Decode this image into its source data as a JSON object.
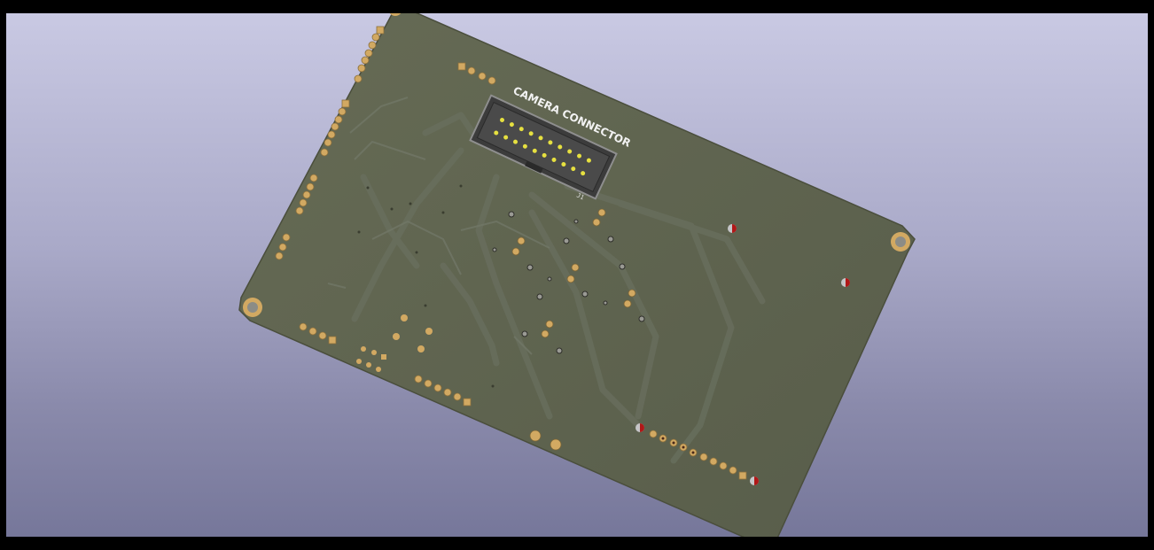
{
  "viewer": {
    "background_top": "#c9c9e3",
    "background_bottom": "#76779a"
  },
  "board": {
    "color": "#5f6450",
    "trace_color": "#6a7060",
    "pad_color": "#d2a962",
    "connector_label": "CAMERA CONNECTOR",
    "connector_ref": "J1"
  }
}
